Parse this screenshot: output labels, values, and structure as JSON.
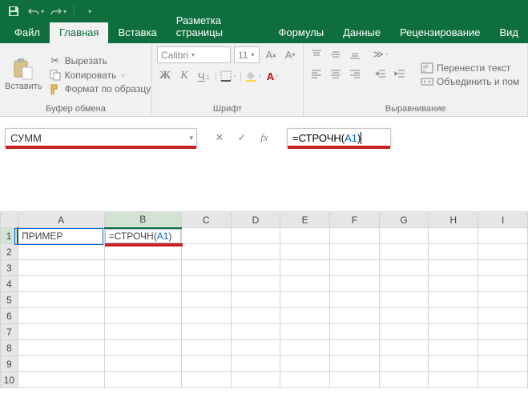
{
  "qat": {
    "save": "save-icon",
    "undo": "undo-icon",
    "redo": "redo-icon"
  },
  "tabs": {
    "file": "Файл",
    "home": "Главная",
    "insert": "Вставка",
    "layout": "Разметка страницы",
    "formulas": "Формулы",
    "data": "Данные",
    "review": "Рецензирование",
    "view": "Вид"
  },
  "ribbon": {
    "clipboard": {
      "paste": "Вставить",
      "cut": "Вырезать",
      "copy": "Копировать",
      "format_painter": "Формат по образцу",
      "label": "Буфер обмена"
    },
    "font": {
      "name": "Calibri",
      "size": "11",
      "label": "Шрифт",
      "bold": "Ж",
      "italic": "К",
      "underline": "Ч"
    },
    "alignment": {
      "wrap": "Перенести текст",
      "merge": "Объединить и пом",
      "label": "Выравнивание"
    }
  },
  "formula_bar": {
    "name_box": "СУММ",
    "formula_prefix": "=СТРОЧН(",
    "formula_ref": "A1",
    "formula_suffix": ")"
  },
  "grid": {
    "cols": [
      "A",
      "B",
      "C",
      "D",
      "E",
      "F",
      "G",
      "H",
      "I"
    ],
    "rows": [
      "1",
      "2",
      "3",
      "4",
      "5",
      "6",
      "7",
      "8",
      "9",
      "10"
    ],
    "A1": "ПРИМЕР",
    "B1_prefix": "=СТРОЧН(",
    "B1_ref": "A1",
    "B1_suffix": ")"
  }
}
